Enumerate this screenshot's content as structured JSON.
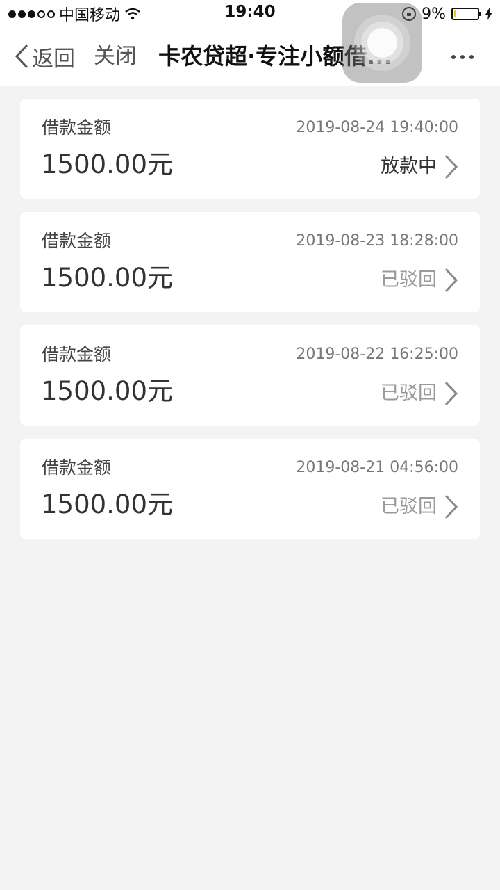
{
  "status_bar": {
    "carrier": "中国移动",
    "time": "19:40",
    "battery_percent": "9%",
    "battery_level": 0.09,
    "battery_color": "#f2c21b"
  },
  "nav": {
    "back_label": "返回",
    "close_label": "关闭",
    "title": "卡农贷超·专注小额借..."
  },
  "loans": [
    {
      "label": "借款金额",
      "date": "2019-08-24 19:40:00",
      "amount": "1500.00元",
      "status": "放款中",
      "status_type": "processing"
    },
    {
      "label": "借款金额",
      "date": "2019-08-23 18:28:00",
      "amount": "1500.00元",
      "status": "已驳回",
      "status_type": "rejected"
    },
    {
      "label": "借款金额",
      "date": "2019-08-22 16:25:00",
      "amount": "1500.00元",
      "status": "已驳回",
      "status_type": "rejected"
    },
    {
      "label": "借款金额",
      "date": "2019-08-21 04:56:00",
      "amount": "1500.00元",
      "status": "已驳回",
      "status_type": "rejected"
    }
  ],
  "colors": {
    "page_background": "#f3f3f3",
    "card_background": "#ffffff",
    "status_rejected": "#9a9a9a",
    "status_processing": "#333333"
  }
}
